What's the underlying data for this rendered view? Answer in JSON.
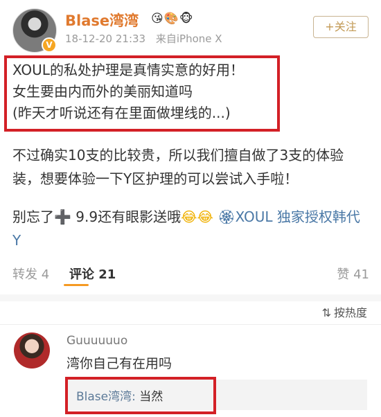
{
  "post": {
    "username": "Blase湾湾",
    "badges": "😘🎨🐵",
    "vip_mark": "V",
    "timestamp": "18-12-20 21:33",
    "source": "来自iPhone X",
    "follow_label": "+关注",
    "highlight_lines": [
      "XOUL的私处护理是真情实意的好用！",
      "女生要由内而外的美丽知道吗",
      "(昨天才听说还有在里面做埋线的...)"
    ],
    "paragraph2": "不过确实10支的比较贵，所以我们擅自做了3支的体验装，想要体验一下Y区护理的可以尝试入手啦！",
    "paragraph3_before": "别忘了",
    "paragraph3_plus": "➕",
    "paragraph3_text": " 9.9还有眼影送哦",
    "paragraph3_emojis": "😂😂",
    "paragraph3_link": "🏵XOUL 独家授权韩代 Y"
  },
  "stats": {
    "repost": "转发 4",
    "comments": "评论 21",
    "likes": "赞 41"
  },
  "sort": {
    "icon": "⇅",
    "label": "按热度"
  },
  "comment": {
    "name": "Guuuuuuo",
    "text": "湾你自己有在用吗",
    "reply_name": "Blase湾湾:",
    "reply_text": " 当然"
  },
  "colors": {
    "highlight_border": "#d32026",
    "username": "#e07a2f",
    "link": "#4a78a6",
    "accent_tab": "#f59a23"
  }
}
